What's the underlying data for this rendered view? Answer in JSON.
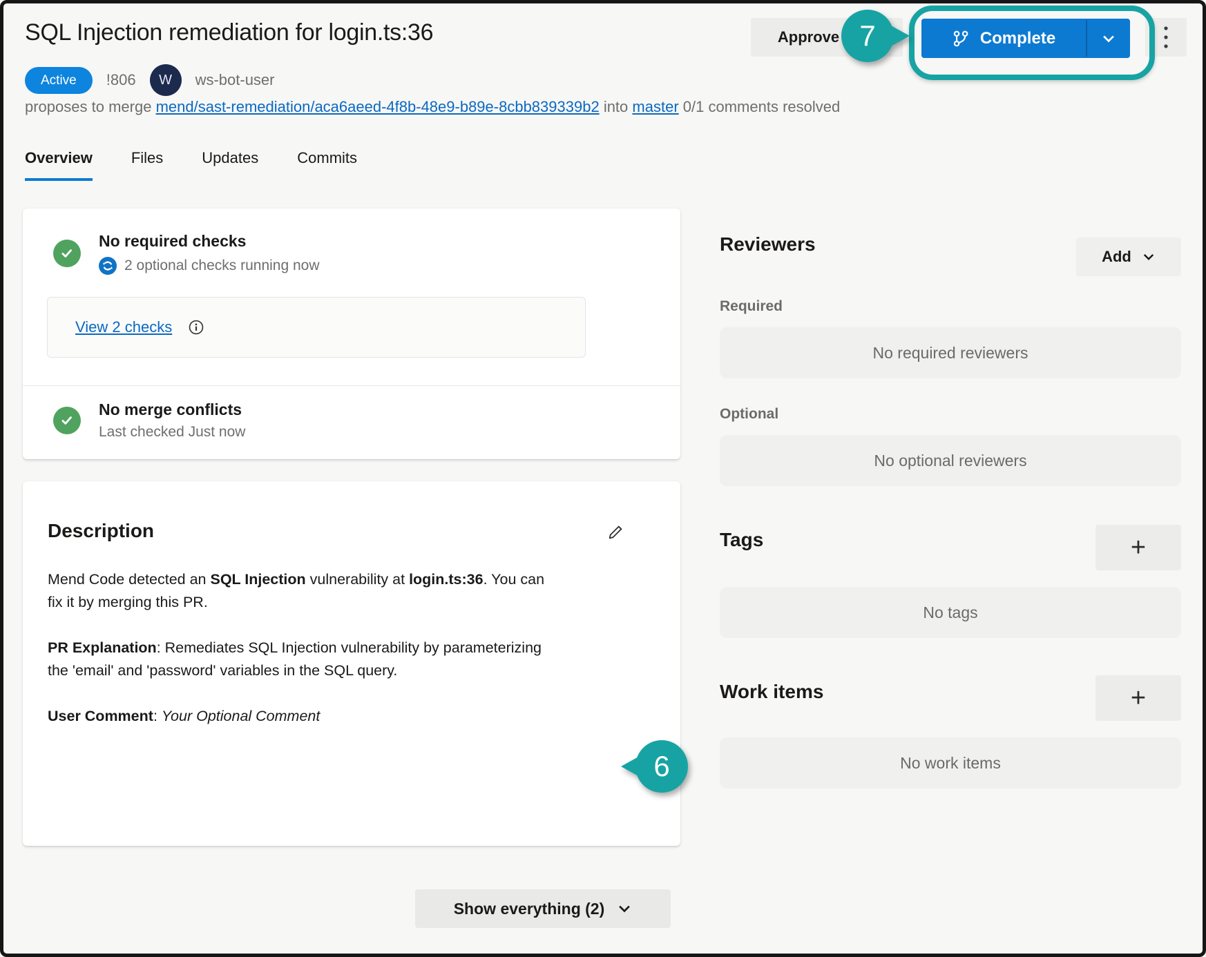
{
  "colors": {
    "accent_blue": "#0d7ad2",
    "link_blue": "#0a69c2",
    "success_green": "#4fa35e",
    "annotation_teal": "#17a3a3",
    "avatar_navy": "#1c2a4e"
  },
  "header": {
    "title": "SQL Injection remediation for login.ts:36",
    "status_badge": "Active",
    "pr_id": "!806",
    "avatar_initial": "W",
    "author": "ws-bot-user",
    "merge_prefix": "proposes to merge",
    "source_branch": "mend/sast-remediation/aca6aeed-4f8b-48e9-b89e-8cbb839339b2",
    "merge_middle": "into",
    "target_branch": "master",
    "merge_suffix": "0/1 comments resolved",
    "approve_label": "Approve",
    "complete_label": "Complete"
  },
  "annotations": {
    "step_6": "6",
    "step_7": "7"
  },
  "tabs": [
    {
      "label": "Overview",
      "active": true
    },
    {
      "label": "Files"
    },
    {
      "label": "Updates"
    },
    {
      "label": "Commits"
    }
  ],
  "checks_card": {
    "required_title": "No required checks",
    "optional_status": "2 optional checks running now",
    "view_checks_label": "View 2 checks",
    "merge_title": "No merge conflicts",
    "merge_status": "Last checked Just now"
  },
  "description_card": {
    "title": "Description",
    "p1": {
      "t1": "Mend Code detected an ",
      "b1": "SQL Injection",
      "t2": " vulnerability at ",
      "b2": "login.ts:36",
      "t3": ". You can fix it by merging this PR."
    },
    "p2": {
      "b1": "PR Explanation",
      "t1": ": Remediates SQL Injection vulnerability by parameterizing the 'email' and 'password' variables in the SQL query."
    },
    "p3": {
      "b1": "User Comment",
      "t1": ": ",
      "i1": "Your Optional Comment"
    }
  },
  "footer": {
    "show_everything_label": "Show everything (2)"
  },
  "sidebar": {
    "reviewers_title": "Reviewers",
    "add_label": "Add",
    "required_label": "Required",
    "required_empty": "No required reviewers",
    "optional_label": "Optional",
    "optional_empty": "No optional reviewers",
    "tags_title": "Tags",
    "tags_empty": "No tags",
    "work_items_title": "Work items",
    "work_items_empty": "No work items",
    "plus_label": "+"
  }
}
